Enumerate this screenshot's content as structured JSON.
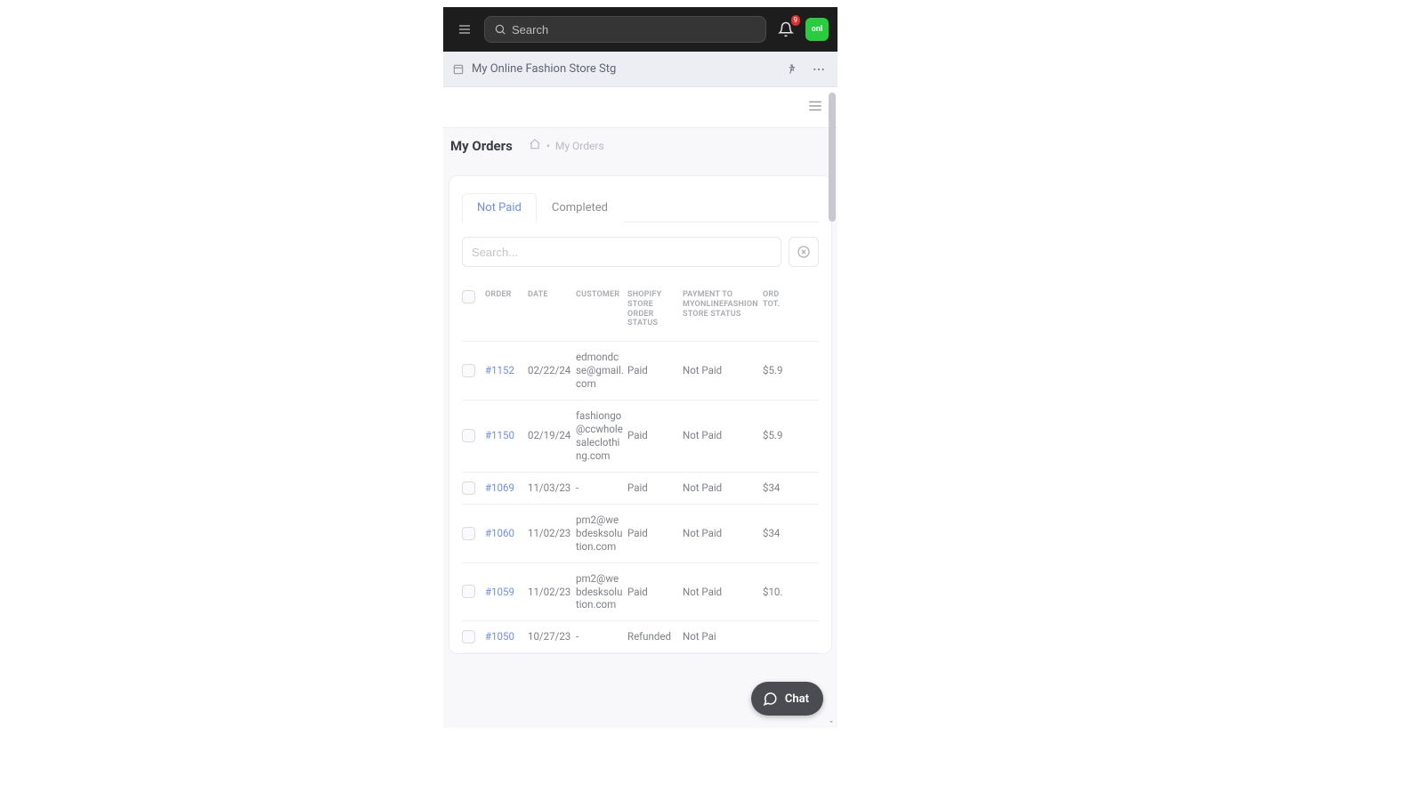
{
  "topbar": {
    "search_placeholder": "Search",
    "notification_count": "9",
    "avatar_initials": "onl"
  },
  "app": {
    "title": "My Online Fashion Store Stg"
  },
  "page": {
    "title": "My Orders",
    "crumb": "My Orders"
  },
  "tabs": {
    "not_paid": "Not Paid",
    "completed": "Completed"
  },
  "filter": {
    "placeholder": "Search..."
  },
  "columns": {
    "order": "ORDER",
    "date": "DATE",
    "customer": "CUSTOMER",
    "shopify": "SHOPIFY STORE ORDER STATUS",
    "payment": "PAYMENT TO MYONLINEFASHION STORE STATUS",
    "total": "ORD TOT."
  },
  "rows": [
    {
      "order": "#1152",
      "date": "02/22/24",
      "customer": "edmondcse@gmail.com",
      "shopify": "Paid",
      "payment": "Not Paid",
      "total": "$5.9"
    },
    {
      "order": "#1150",
      "date": "02/19/24",
      "customer": "fashiongo@ccwholesaleclothing.com",
      "shopify": "Paid",
      "payment": "Not Paid",
      "total": "$5.9"
    },
    {
      "order": "#1069",
      "date": "11/03/23",
      "customer": "-",
      "shopify": "Paid",
      "payment": "Not Paid",
      "total": "$34"
    },
    {
      "order": "#1060",
      "date": "11/02/23",
      "customer": "pm2@webdesksolution.com",
      "shopify": "Paid",
      "payment": "Not Paid",
      "total": "$34"
    },
    {
      "order": "#1059",
      "date": "11/02/23",
      "customer": "pm2@webdesksolution.com",
      "shopify": "Paid",
      "payment": "Not Paid",
      "total": "$10."
    },
    {
      "order": "#1050",
      "date": "10/27/23",
      "customer": "-",
      "shopify": "Refunded",
      "payment": "Not Pai",
      "total": ""
    }
  ],
  "chat": {
    "label": "Chat"
  }
}
